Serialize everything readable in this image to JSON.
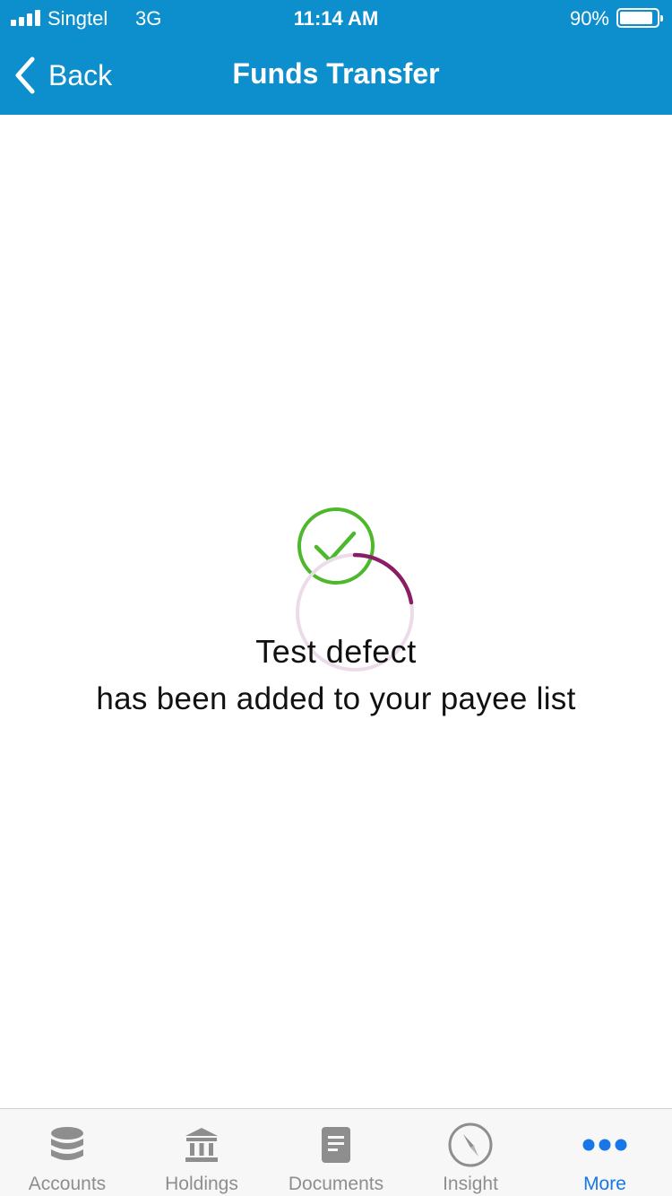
{
  "status_bar": {
    "carrier": "Singtel",
    "network": "3G",
    "time": "11:14 AM",
    "battery_percent": "90%",
    "battery_level": 0.9
  },
  "nav": {
    "back_label": "Back",
    "title": "Funds Transfer"
  },
  "confirmation": {
    "payee_name": "Test defect",
    "message": "has been added to your payee list"
  },
  "tab_bar": {
    "tabs": [
      {
        "label": "Accounts",
        "icon": "accounts-icon",
        "active": false
      },
      {
        "label": "Holdings",
        "icon": "holdings-icon",
        "active": false
      },
      {
        "label": "Documents",
        "icon": "documents-icon",
        "active": false
      },
      {
        "label": "Insight",
        "icon": "insight-icon",
        "active": false
      },
      {
        "label": "More",
        "icon": "more-icon",
        "active": true
      }
    ]
  },
  "colors": {
    "header": "#0e8fcd",
    "success": "#4db82c",
    "spinner": "#8a1d63",
    "tab_active": "#1877e6",
    "tab_inactive": "#8e8e8e"
  }
}
